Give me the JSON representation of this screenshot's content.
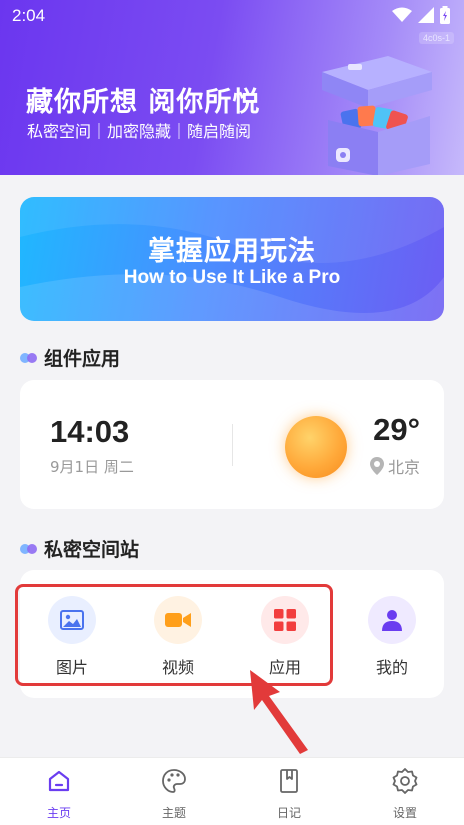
{
  "status": {
    "time": "2:04",
    "build": "4c0s-1"
  },
  "header": {
    "title": "藏你所想 阅你所悦",
    "subtitle": "私密空间｜加密隐藏｜随启随阅"
  },
  "banner": {
    "title": "掌握应用玩法",
    "subtitle": "How to Use It Like a Pro"
  },
  "widgets": {
    "section_title": "组件应用",
    "time": "14:03",
    "date": "9月1日 周二",
    "temperature": "29°",
    "location": "北京"
  },
  "space": {
    "section_title": "私密空间站",
    "items": [
      {
        "label": "图片",
        "icon": "image-icon",
        "bg": "#e9efff",
        "color": "#4a73ee"
      },
      {
        "label": "视频",
        "icon": "video-camera-icon",
        "bg": "#fff2e2",
        "color": "#ff9f1a"
      },
      {
        "label": "应用",
        "icon": "apps-grid-icon",
        "bg": "#ffe9e9",
        "color": "#f23e3e"
      },
      {
        "label": "我的",
        "icon": "user-icon",
        "bg": "#efeaff",
        "color": "#6a3df0"
      }
    ]
  },
  "nav": {
    "items": [
      {
        "label": "主页",
        "icon": "home-icon",
        "active": true
      },
      {
        "label": "主题",
        "icon": "palette-icon",
        "active": false
      },
      {
        "label": "日记",
        "icon": "bookmark-icon",
        "active": false
      },
      {
        "label": "设置",
        "icon": "gear-icon",
        "active": false
      }
    ]
  },
  "colors": {
    "accent": "#6a3df0",
    "highlight": "#e23a3a"
  }
}
